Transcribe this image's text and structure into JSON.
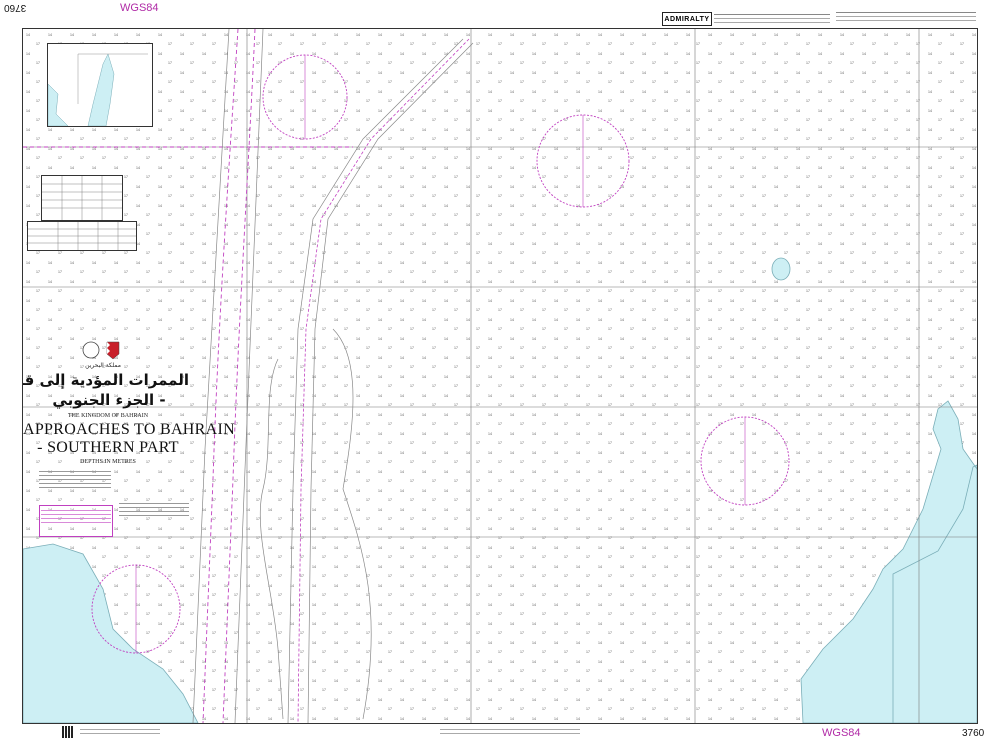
{
  "header": {
    "chart_number_top": "3760",
    "datum_top": "WGS84",
    "publisher_badge": "ADMIRALTY"
  },
  "footer": {
    "datum_bottom": "WGS84",
    "chart_number_bottom": "3760"
  },
  "title_block": {
    "arabic_kingdom": "مملكة البحرين",
    "arabic_title_line1": "الممرات المؤدية إلى قناة البحرين",
    "arabic_title_line2": "- الجزء الجنوبي",
    "kingdom": "THE KINGDOM OF BAHRAIN",
    "title_line1": "APPROACHES TO BAHRAIN",
    "title_line2": "- SOUTHERN PART",
    "depths_label": "DEPTHS IN METRES"
  },
  "colors": {
    "land": "#cdeff4",
    "magenta": "#c040c0",
    "grid": "#555555",
    "frame": "#333333"
  }
}
